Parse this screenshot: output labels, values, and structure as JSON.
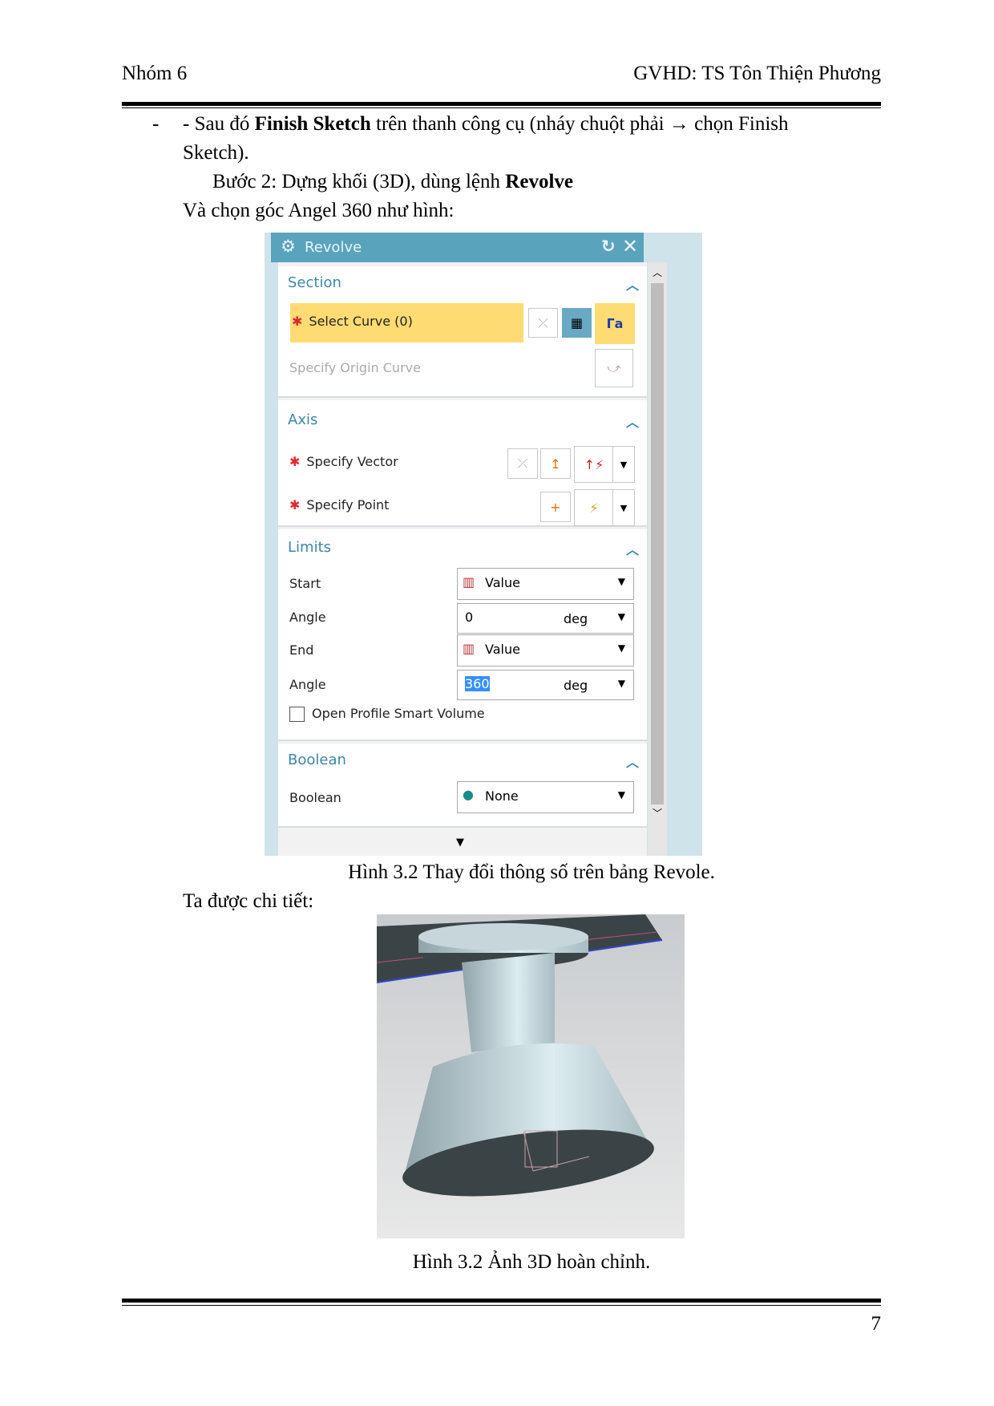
{
  "header": {
    "left": "Nhóm 6",
    "right": "GVHD: TS Tôn Thiện Phương"
  },
  "body": {
    "bullet": "-",
    "line1_pre": "- Sau đó ",
    "line1_bold": "Finish Sketch",
    "line1_post": " trên thanh công cụ (nháy chuột phải → chọn Finish",
    "line2": "Sketch).",
    "line3_pre": "Bước 2: Dựng khối (3D), dùng lệnh ",
    "line3_bold": "Revolve",
    "line4": "Và chọn góc Angel 360 như hình:",
    "caption1": "Hình 3.2 Thay đổi thông số trên bảng Revole.",
    "line5": "Ta được chi tiết:",
    "caption2": "Hình 3.2 Ảnh 3D hoàn chỉnh."
  },
  "dialog": {
    "title": "Revolve",
    "icons": [
      "gear-icon",
      "reset-icon",
      "close-icon"
    ],
    "accent": "#5aa3bd",
    "highlight": "#ffdc73",
    "section": {
      "header": "Section",
      "select_curve": "Select Curve (0)",
      "origin_curve": "Specify Origin Curve"
    },
    "axis": {
      "header": "Axis",
      "vector": "Specify Vector",
      "point": "Specify Point"
    },
    "limits": {
      "header": "Limits",
      "start_label": "Start",
      "start_value": "Value",
      "angle1_label": "Angle",
      "angle1_value": "0",
      "unit": "deg",
      "end_label": "End",
      "end_value": "Value",
      "angle2_label": "Angle",
      "angle2_value": "360",
      "checkbox": "Open Profile Smart Volume",
      "checkbox_checked": false
    },
    "boolean": {
      "header": "Boolean",
      "label": "Boolean",
      "value": "None"
    },
    "required_mark": "✱"
  },
  "footer": {
    "page": "7"
  }
}
